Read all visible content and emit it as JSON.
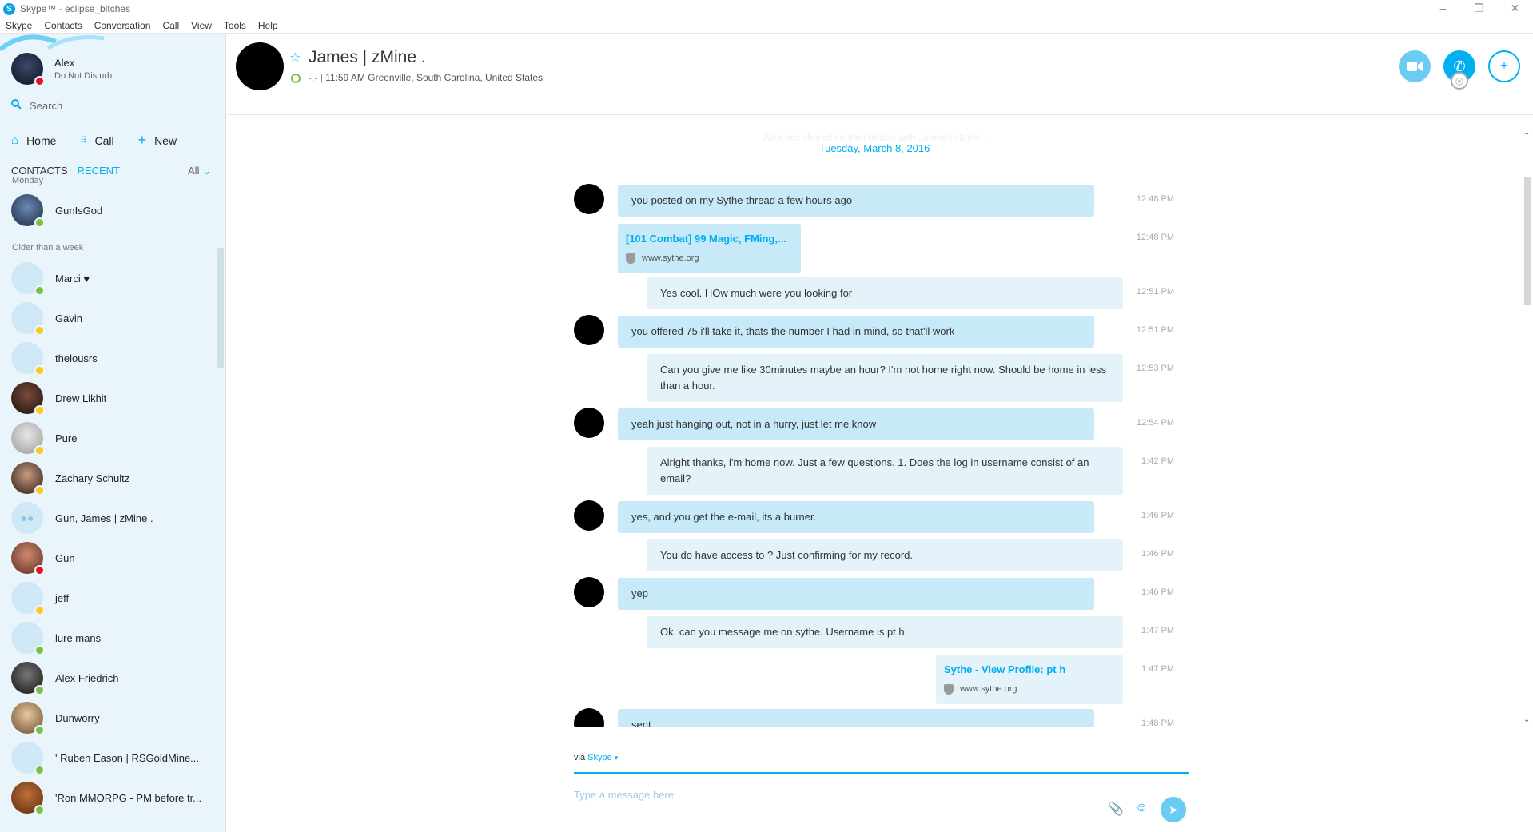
{
  "window": {
    "title": "Skype™ - eclipse_bitches",
    "logo": "S"
  },
  "menu": [
    "Skype",
    "Contacts",
    "Conversation",
    "Call",
    "View",
    "Tools",
    "Help"
  ],
  "profile": {
    "name": "Alex",
    "status": "Do Not Disturb",
    "status_color": "#e81123"
  },
  "search": {
    "placeholder": "Search"
  },
  "nav": {
    "home": "Home",
    "call": "Call",
    "new": "New"
  },
  "tabs": {
    "contacts": "CONTACTS",
    "recent": "RECENT",
    "filter": "All"
  },
  "groups": {
    "monday": "Monday",
    "older": "Older than a week"
  },
  "contacts": [
    {
      "name": "GunIsGod",
      "status": "online",
      "avatar": "photo"
    },
    {
      "name": "Marci ♥",
      "status": "online",
      "avatar": "default"
    },
    {
      "name": "Gavin",
      "status": "away",
      "avatar": "default"
    },
    {
      "name": "thelousrs",
      "status": "away",
      "avatar": "default"
    },
    {
      "name": "Drew Likhit",
      "status": "away",
      "avatar": "photo"
    },
    {
      "name": "Pure",
      "status": "away",
      "avatar": "photo"
    },
    {
      "name": "Zachary Schultz",
      "status": "away",
      "avatar": "photo"
    },
    {
      "name": "Gun, James |  zMine .",
      "status": "none",
      "avatar": "group"
    },
    {
      "name": "Gun",
      "status": "dnd",
      "avatar": "photo"
    },
    {
      "name": "jeff",
      "status": "away",
      "avatar": "default"
    },
    {
      "name": "lure mans",
      "status": "online",
      "avatar": "default"
    },
    {
      "name": "Alex Friedrich",
      "status": "online",
      "avatar": "photo"
    },
    {
      "name": "Dunworry",
      "status": "online",
      "avatar": "photo"
    },
    {
      "name": "'   Ruben Eason  | RSGoldMine...",
      "status": "online",
      "avatar": "default"
    },
    {
      "name": "'Ron MMORPG - PM before tr...",
      "status": "online",
      "avatar": "photo"
    }
  ],
  "conversation": {
    "name": "James |  zMine .",
    "location": "-.- | 11:59 AM Greenville, South Carolina, United States",
    "shared_notice": "Alex has shared contact details with James |  zMine .",
    "date": "Tuesday, March 8, 2016"
  },
  "messages": [
    {
      "dir": "in",
      "text": "you posted on my Sythe thread a few hours ago",
      "time": "12:48 PM"
    },
    {
      "dir": "in",
      "link_title": "[101 Combat] 99 Magic, FMing,...",
      "link_host": "www.sythe.org",
      "time": "12:48 PM"
    },
    {
      "dir": "out",
      "text": "Yes cool. HOw much were you looking for",
      "time": "12:51 PM"
    },
    {
      "dir": "in",
      "text": "you offered 75 i'll take it, thats the number I had in mind, so that'll work",
      "time": "12:51 PM"
    },
    {
      "dir": "out",
      "text": "Can you give me like 30minutes maybe an hour? I'm not home right now. Should be home in less than a hour.",
      "time": "12:53 PM"
    },
    {
      "dir": "in",
      "text": "yeah just hanging out, not in a hurry, just let me know",
      "time": "12:54 PM"
    },
    {
      "dir": "out",
      "text": "Alright thanks, i'm home now. Just a few questions. 1. Does the log in username consist of an email?",
      "time": "1:42 PM"
    },
    {
      "dir": "in",
      "text": "yes, and you get the e-mail, its a burner.",
      "time": "1:46 PM"
    },
    {
      "dir": "out",
      "text": "You do have access to ? Just confirming for my record.",
      "time": "1:46 PM"
    },
    {
      "dir": "in",
      "text": "yep",
      "time": "1:46 PM"
    },
    {
      "dir": "out",
      "text": "Ok. can you message me on sythe. Username is pt h",
      "time": "1:47 PM"
    },
    {
      "dir": "out",
      "link_title": "Sythe - View Profile: pt h",
      "link_host": "www.sythe.org",
      "time": "1:47 PM"
    },
    {
      "dir": "in",
      "text": "sent",
      "time": "1:48 PM"
    }
  ],
  "compose": {
    "via_label": "via",
    "via_service": "Skype",
    "placeholder": "Type a message here"
  },
  "icons": [
    "skype-logo-icon",
    "minimize-icon",
    "restore-icon",
    "close-icon",
    "search-icon",
    "home-icon",
    "dialpad-icon",
    "plus-icon",
    "chevron-down-icon",
    "star-icon",
    "video-icon",
    "phone-icon",
    "add-person-icon",
    "globe-icon",
    "attach-icon",
    "emoji-icon",
    "send-icon"
  ],
  "colors": {
    "accent": "#00aff0",
    "incoming": "#c7e9f8",
    "outgoing": "#e4f3fa",
    "online": "#7ac143",
    "away": "#fdc817",
    "dnd": "#e81123"
  }
}
